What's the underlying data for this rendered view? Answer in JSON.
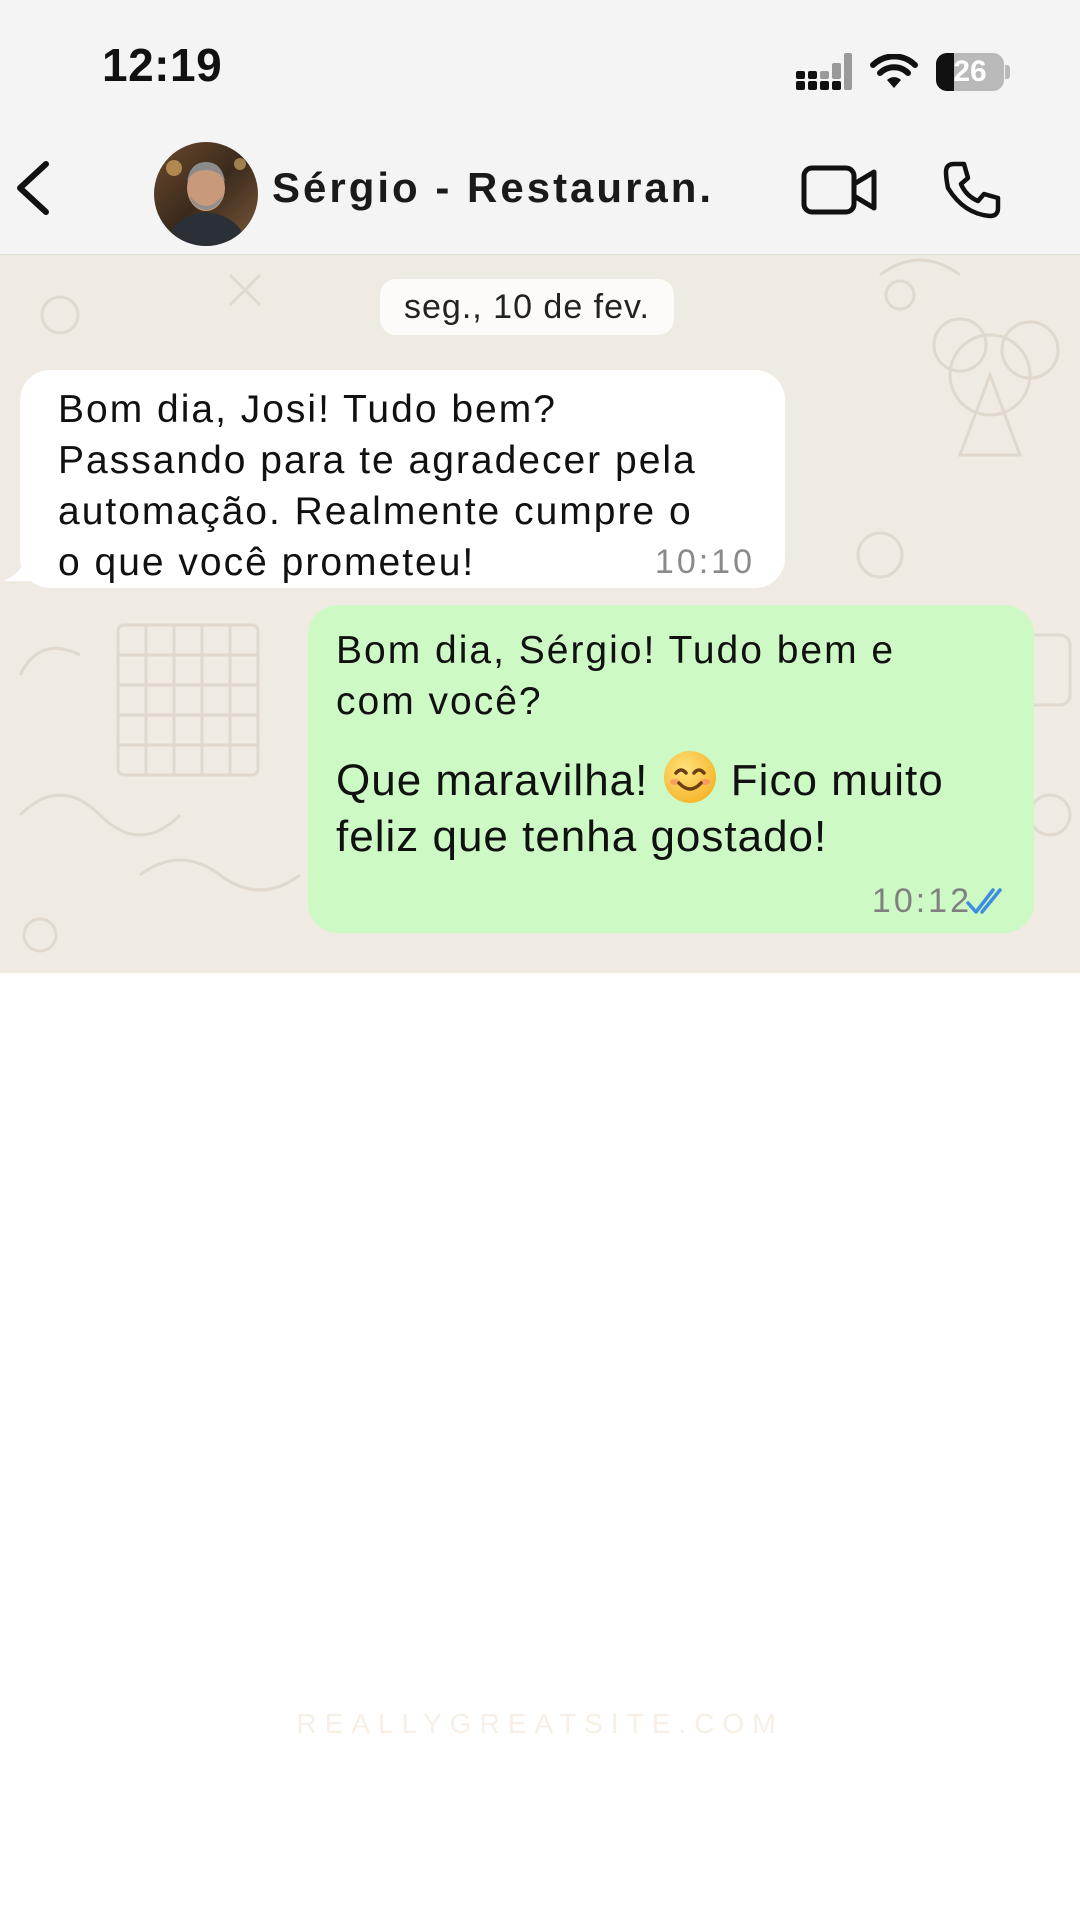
{
  "status_bar": {
    "time": "12:19",
    "battery_level": "26",
    "battery_fraction": 0.26,
    "icons": [
      "cellular-signal-icon",
      "wifi-icon",
      "battery-icon"
    ]
  },
  "header": {
    "contact_name": "Sérgio - Restauran.",
    "icons": [
      "back-chevron-icon",
      "video-camera-icon",
      "phone-icon"
    ]
  },
  "chat": {
    "date_label": "seg., 10 de fev.",
    "messages": [
      {
        "direction": "incoming",
        "text": "Bom dia, Josi! Tudo bem?\nPassando para te agradecer pela\nautomação. Realmente cumpre o\no que você prometeu!",
        "time": "10:10"
      },
      {
        "direction": "outgoing",
        "text": "Bom dia, Sérgio! Tudo bem e\ncom você?",
        "text_2_before_emoji": "Que maravilha! ",
        "emoji": "smiling-face-icon",
        "text_2_after_emoji": " Fico muito\nfeliz que tenha gostado!",
        "time": "10:12",
        "status": "read"
      }
    ]
  },
  "watermark": "REALLYGREATSITE.COM",
  "colors": {
    "chat_background": "#efeae2",
    "incoming_bubble": "#ffffff",
    "outgoing_bubble": "#cdf9c4",
    "read_receipt": "#3d8ee0"
  }
}
